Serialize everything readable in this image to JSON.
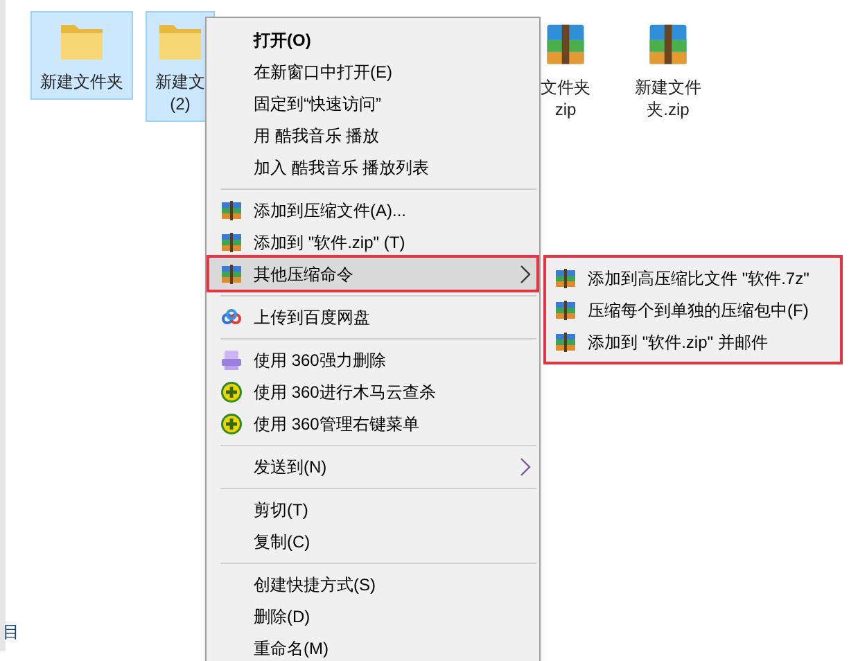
{
  "files": [
    {
      "kind": "folder",
      "lines": [
        "新建文件夹"
      ],
      "selected": true
    },
    {
      "kind": "folder",
      "lines": [
        "新建文",
        "(2)"
      ],
      "selected": true
    },
    {
      "kind": "zip",
      "lines": [
        "文件夹",
        "zip"
      ],
      "selected": false
    },
    {
      "kind": "zip",
      "lines": [
        "新建文件",
        "夹.zip"
      ],
      "selected": false
    }
  ],
  "status_bar": {
    "text": "目"
  },
  "context_menu": {
    "items": [
      {
        "kind": "default",
        "label": "打开(O)",
        "submenu": false,
        "selected": false
      },
      {
        "kind": "plain",
        "label": "在新窗口中打开(E)",
        "submenu": false,
        "selected": false
      },
      {
        "kind": "plain",
        "label": "固定到“快速访问”",
        "submenu": false,
        "selected": false
      },
      {
        "kind": "plain",
        "label": "用 酷我音乐 播放",
        "submenu": false,
        "selected": false
      },
      {
        "kind": "plain",
        "label": "加入 酷我音乐 播放列表",
        "submenu": false,
        "selected": false
      },
      {
        "kind": "separator"
      },
      {
        "kind": "archive",
        "label": "添加到压缩文件(A)...",
        "submenu": false,
        "selected": false
      },
      {
        "kind": "archive",
        "label": "添加到 \"软件.zip\" (T)",
        "submenu": false,
        "selected": false
      },
      {
        "kind": "archive",
        "label": "其他压缩命令",
        "submenu": true,
        "selected": true
      },
      {
        "kind": "separator"
      },
      {
        "kind": "cloud",
        "label": "上传到百度网盘",
        "submenu": false,
        "selected": false
      },
      {
        "kind": "separator"
      },
      {
        "kind": "shredder",
        "label": "使用 360强力删除",
        "submenu": false,
        "selected": false
      },
      {
        "kind": "shield",
        "label": "使用 360进行木马云查杀",
        "submenu": false,
        "selected": false
      },
      {
        "kind": "shield",
        "label": "使用 360管理右键菜单",
        "submenu": false,
        "selected": false
      },
      {
        "kind": "separator"
      },
      {
        "kind": "plain",
        "label": "发送到(N)",
        "submenu": true,
        "selected": false
      },
      {
        "kind": "separator"
      },
      {
        "kind": "plain",
        "label": "剪切(T)",
        "submenu": false,
        "selected": false
      },
      {
        "kind": "plain",
        "label": "复制(C)",
        "submenu": false,
        "selected": false
      },
      {
        "kind": "separator"
      },
      {
        "kind": "plain",
        "label": "创建快捷方式(S)",
        "submenu": false,
        "selected": false
      },
      {
        "kind": "plain",
        "label": "删除(D)",
        "submenu": false,
        "selected": false
      },
      {
        "kind": "plain",
        "label": "重命名(M)",
        "submenu": false,
        "selected": false
      }
    ]
  },
  "submenu": {
    "items": [
      {
        "kind": "archive",
        "label": "添加到高压缩比文件 \"软件.7z\""
      },
      {
        "kind": "archive",
        "label": "压缩每个到单独的压缩包中(F)"
      },
      {
        "kind": "archive",
        "label": "添加到 \"软件.zip\" 并邮件"
      }
    ]
  }
}
